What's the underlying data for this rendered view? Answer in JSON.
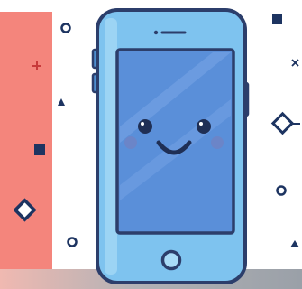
{
  "illustration": {
    "subject": "smartphone-mascot",
    "colors": {
      "outline": "#2c3e6b",
      "phone_body": "#7ec3ef",
      "screen": "#5a8fd9",
      "panel": "#f4857c",
      "cheeks": "#6b85c8",
      "decor": "#1d3461"
    },
    "decor_icons": [
      "plus-icon",
      "triangle-icon",
      "square-icon",
      "diamond-icon",
      "circle-icon",
      "cross-icon"
    ]
  }
}
